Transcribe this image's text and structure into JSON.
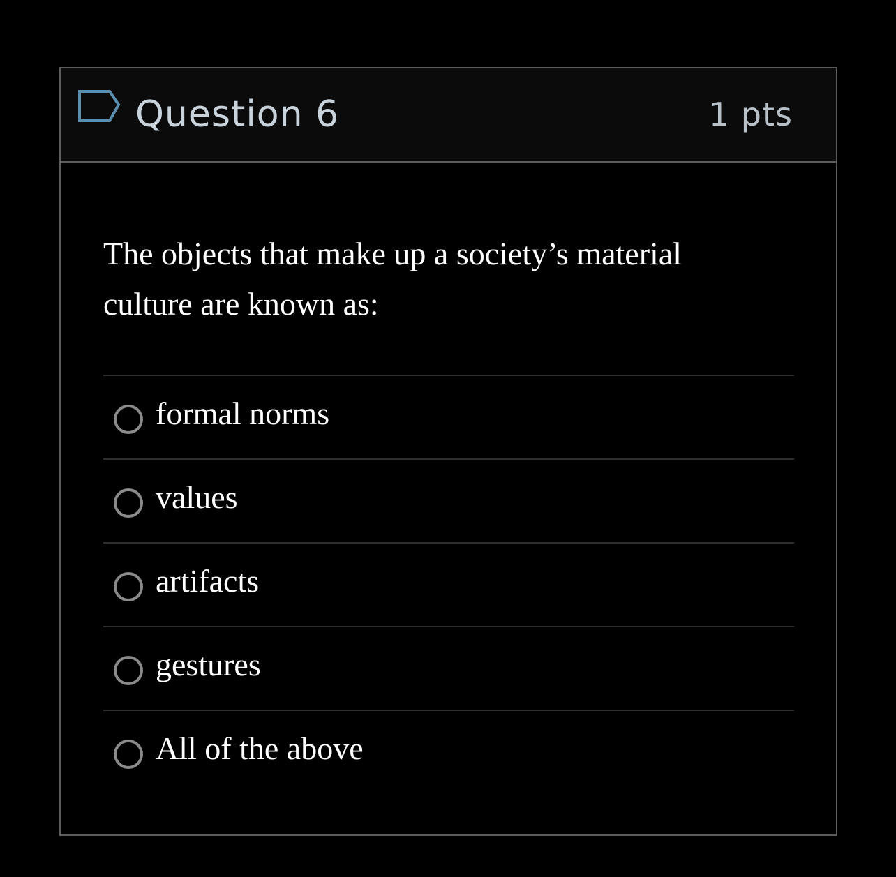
{
  "question": {
    "title": "Question 6",
    "points": "1 pts",
    "flag_icon": "flag-icon",
    "text": "The objects that make up a society’s material culture are known as:",
    "answers": [
      {
        "label": "formal norms"
      },
      {
        "label": "values"
      },
      {
        "label": "artifacts"
      },
      {
        "label": "gestures"
      },
      {
        "label": "All of the above"
      }
    ]
  },
  "colors": {
    "background": "#000000",
    "header_background": "#0b0b0b",
    "border": "#5c5c5c",
    "title_text": "#c9d3dc",
    "flag_outline": "#5a8fb0",
    "radio_border": "#8a8a8a",
    "body_text": "#ffffff"
  }
}
